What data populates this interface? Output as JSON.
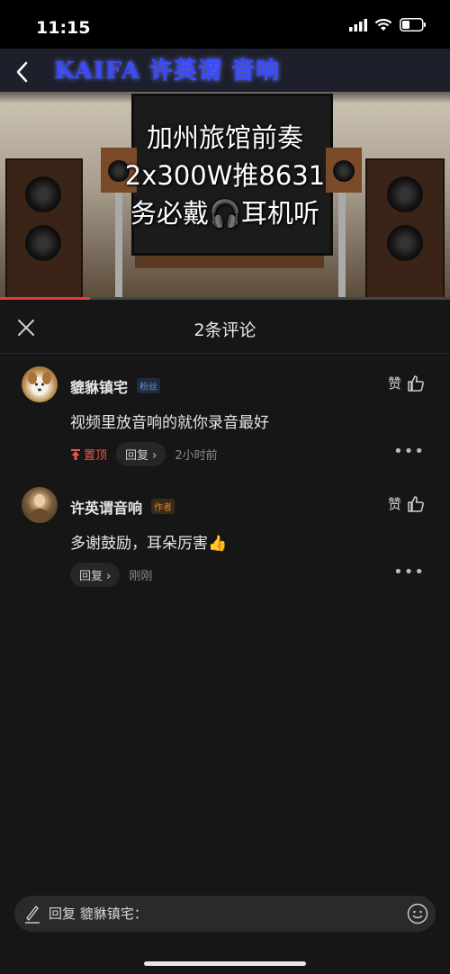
{
  "status_bar": {
    "time": "11:15"
  },
  "video": {
    "banner_text": "KAIFA 许英谓 音响",
    "caption_lines": [
      "加州旅馆前奏",
      "2x300W推8631",
      "务必戴🎧耳机听"
    ],
    "progress": 0.2
  },
  "comments_panel": {
    "title": "2条评论",
    "comments": [
      {
        "author": "貔貅镇宅",
        "tag": "粉丝",
        "like_label": "赞",
        "text": "视频里放音响的就你录音最好",
        "pinned_label": "置顶",
        "reply_label": "回复",
        "time": "2小时前"
      },
      {
        "author": "许英谓音响",
        "tag": "作者",
        "like_label": "赞",
        "text": "多谢鼓励，耳朵厉害👍",
        "reply_label": "回复",
        "time": "刚刚"
      }
    ]
  },
  "reply_input": {
    "placeholder": "回复 貔貅镇宅："
  },
  "colors": {
    "accent_red": "#e8574b",
    "fan_tag": "#5b8ddc",
    "author_tag": "#d4862e",
    "background": "#161616"
  }
}
